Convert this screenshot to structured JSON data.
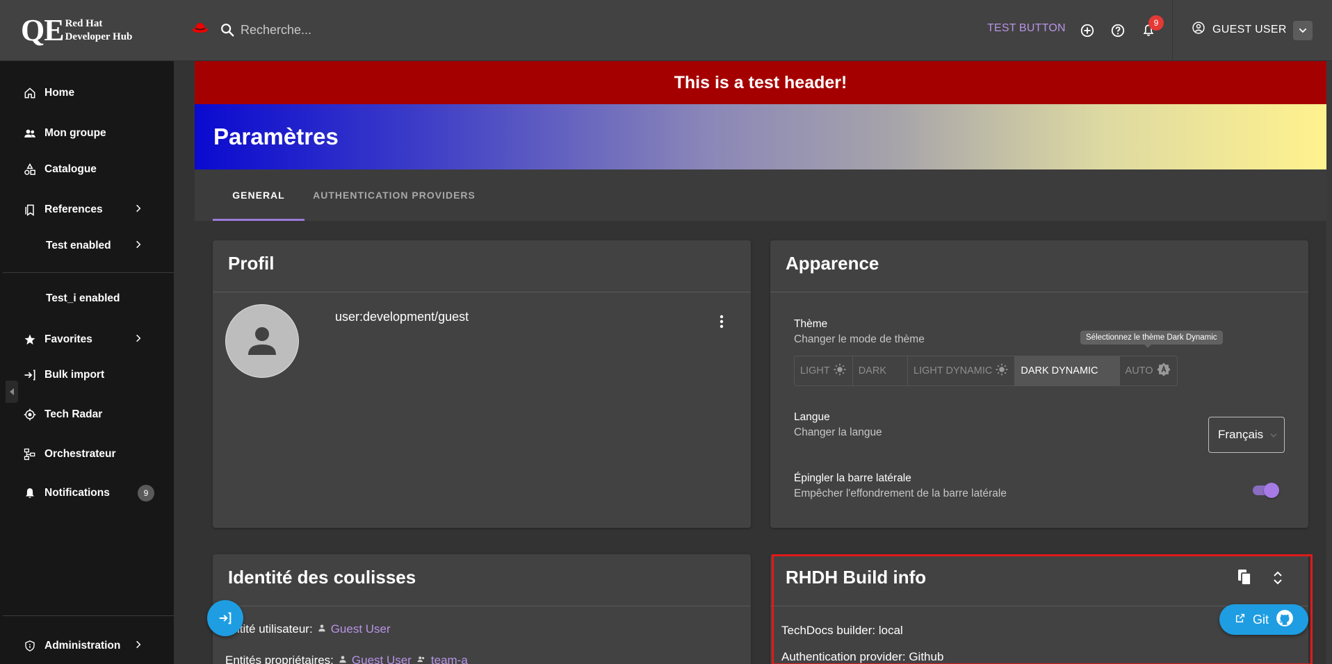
{
  "topbar": {
    "logo_qe": "QE",
    "logo_line1": "Red Hat",
    "logo_line2": "Developer Hub",
    "search_placeholder": "Recherche...",
    "test_button": "TEST BUTTON",
    "notification_count": "9",
    "user_name": "GUEST USER"
  },
  "sidebar": {
    "items": [
      {
        "label": "Home",
        "icon": "home-icon"
      },
      {
        "label": "Mon groupe",
        "icon": "group-icon"
      },
      {
        "label": "Catalogue",
        "icon": "catalog-icon"
      },
      {
        "label": "References",
        "icon": "bookmark-icon"
      },
      {
        "label": "Test enabled",
        "icon": ""
      },
      {
        "label": "Test_i enabled",
        "icon": ""
      },
      {
        "label": "Favorites",
        "icon": "star-icon"
      },
      {
        "label": "Bulk import",
        "icon": "login-arrow-icon"
      },
      {
        "label": "Tech Radar",
        "icon": "radar-icon"
      },
      {
        "label": "Orchestrateur",
        "icon": "workflow-icon"
      },
      {
        "label": "Notifications",
        "icon": "bell-icon"
      },
      {
        "label": "Administration",
        "icon": "shield-icon"
      }
    ],
    "notifications_badge": "9"
  },
  "banner": {
    "text": "This is a test header!",
    "page_title": "Paramètres"
  },
  "tabs": [
    {
      "label": "GENERAL",
      "active": true
    },
    {
      "label": "AUTHENTICATION PROVIDERS",
      "active": false
    }
  ],
  "profile": {
    "title": "Profil",
    "user_ref": "user:development/guest"
  },
  "appearance": {
    "title": "Apparence",
    "theme_label": "Thème",
    "theme_sub": "Changer le mode de thème",
    "theme_options": [
      "LIGHT",
      "DARK",
      "LIGHT DYNAMIC",
      "DARK DYNAMIC",
      "AUTO"
    ],
    "selected_theme": "DARK DYNAMIC",
    "tooltip": "Sélectionnez le thème Dark Dynamic",
    "language_label": "Langue",
    "language_sub": "Changer la langue",
    "language_value": "Français",
    "pin_label": "Épingler la barre latérale",
    "pin_sub": "Empêcher l'effondrement de la barre latérale",
    "pin_enabled": true
  },
  "identity": {
    "title": "Identité des coulisses",
    "user_entity_label": "Entité utilisateur:",
    "user_entity_value": "Guest User",
    "owner_label": "Entités propriétaires:",
    "owner_values": [
      "Guest User",
      "team-a"
    ]
  },
  "build_info": {
    "title": "RHDH Build info",
    "lines": [
      "TechDocs builder: local",
      "Authentication provider: Github"
    ],
    "git_button": "Git"
  },
  "colors": {
    "accent": "#9c7ad8",
    "link": "#b794e6",
    "test_header_bg": "#a50000",
    "fab": "#1e9de2",
    "highlight_border": "#e01a1a"
  }
}
